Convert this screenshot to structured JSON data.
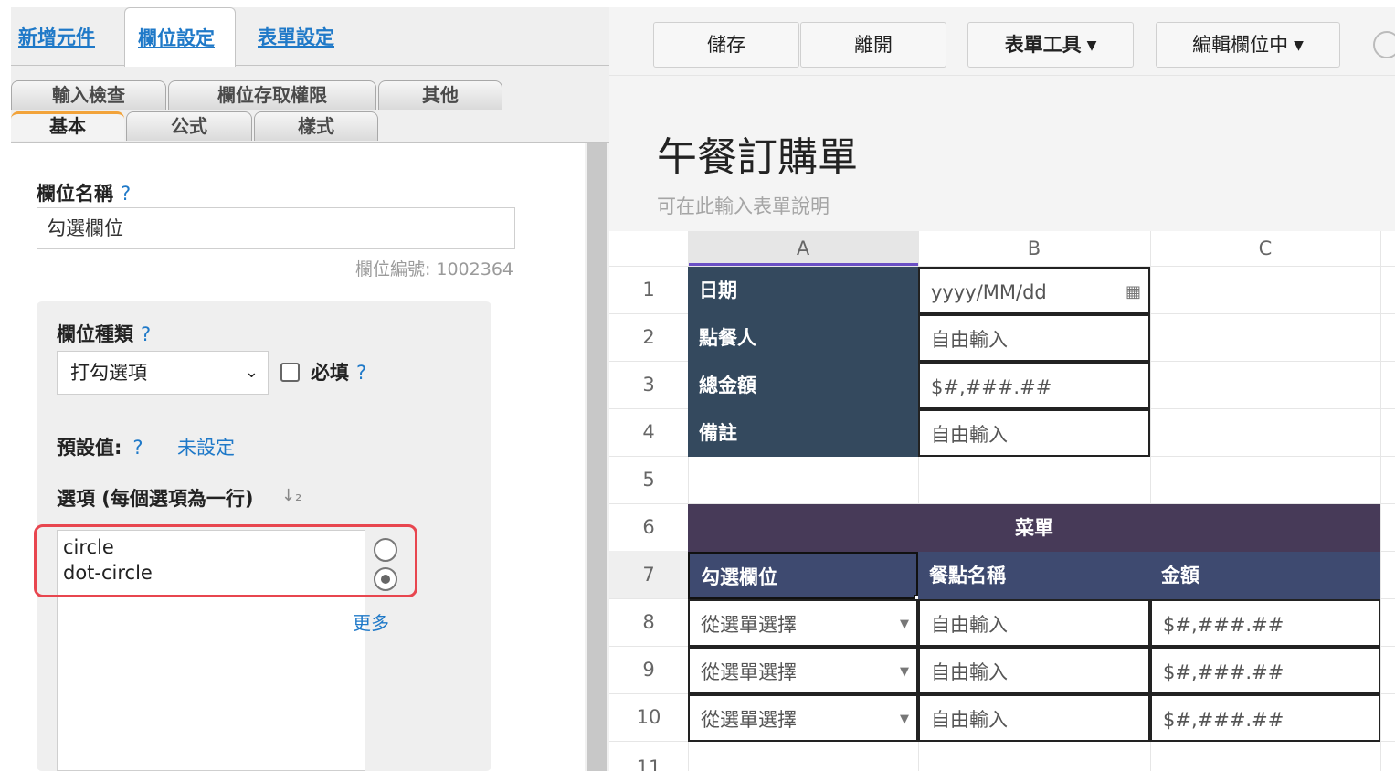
{
  "left": {
    "top_tabs": [
      {
        "label": "新增元件",
        "active": false
      },
      {
        "label": "欄位設定",
        "active": true
      },
      {
        "label": "表單設定",
        "active": false
      }
    ],
    "sub_tabs_row1": [
      {
        "label": "輸入檢查"
      },
      {
        "label": "欄位存取權限"
      },
      {
        "label": "其他"
      }
    ],
    "sub_tabs_row2": [
      {
        "label": "基本",
        "active": true
      },
      {
        "label": "公式"
      },
      {
        "label": "樣式"
      }
    ],
    "field_name_label": "欄位名稱",
    "help_mark": "?",
    "field_name_value": "勾選欄位",
    "field_number": "欄位編號: 1002364",
    "field_type_label": "欄位種類",
    "field_type_value": "打勾選項",
    "required_label": "必填",
    "default_label": "預設值:",
    "default_value": "未設定",
    "options_label": "選項 (每個選項為一行)",
    "options": [
      "circle",
      "dot-circle"
    ],
    "more_label": "更多"
  },
  "right": {
    "toolbar": {
      "save": "儲存",
      "leave": "離開",
      "form_tools": "表單工具",
      "editing": "編輯欄位中"
    },
    "form_title": "午餐訂購單",
    "form_description": "可在此輸入表單說明",
    "columns": [
      "A",
      "B",
      "C"
    ],
    "rows": [
      "1",
      "2",
      "3",
      "4",
      "5",
      "6",
      "7",
      "8",
      "9",
      "10",
      "11"
    ],
    "info_labels": [
      "日期",
      "點餐人",
      "總金額",
      "備註"
    ],
    "info_values": [
      "yyyy/MM/dd",
      "自由輸入",
      "$#,###.##",
      "自由輸入"
    ],
    "menu_title": "菜單",
    "menu_headers": [
      "勾選欄位",
      "餐點名稱",
      "金額"
    ],
    "menu_rows": [
      [
        "從選單選擇",
        "自由輸入",
        "$#,###.##"
      ],
      [
        "從選單選擇",
        "自由輸入",
        "$#,###.##"
      ],
      [
        "從選單選擇",
        "自由輸入",
        "$#,###.##"
      ]
    ]
  },
  "colors": {
    "link_blue": "#1f79c8",
    "header_dark": "#34495e",
    "header_navy": "#3e4a70",
    "menu_purple": "#473a58",
    "highlight_red": "#e8464f",
    "active_tab_orange": "#f2a33a"
  },
  "icons": {
    "calendar": "calendar-icon",
    "dropdown": "chevron-down-icon",
    "radio_empty": "circle-icon",
    "radio_dot": "dot-circle-icon",
    "sort": "sort-icon"
  }
}
